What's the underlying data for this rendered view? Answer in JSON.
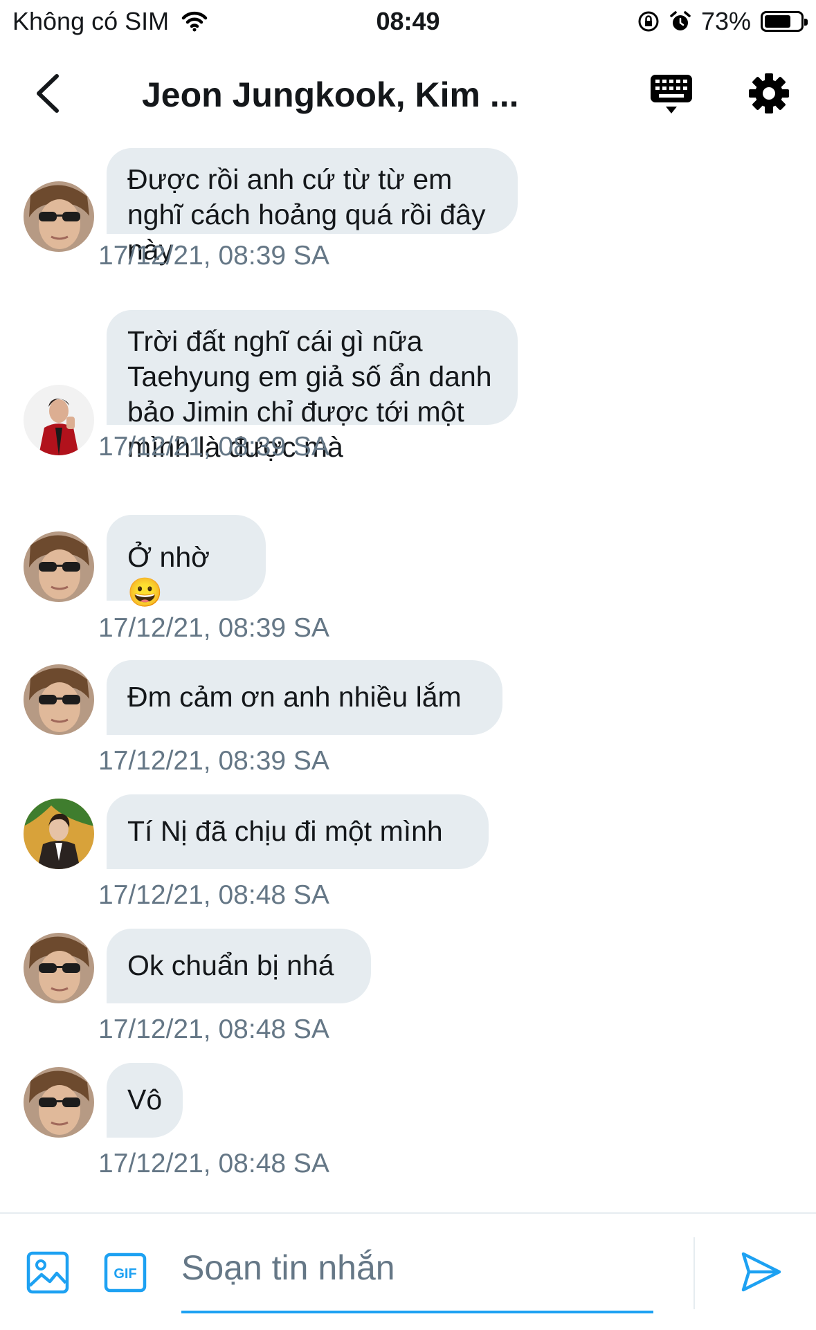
{
  "status_bar": {
    "carrier": "Không có SIM",
    "time": "08:49",
    "battery": "73%",
    "battery_level": 0.73
  },
  "header": {
    "title": "Jeon Jungkook, Kim ..."
  },
  "messages": [
    {
      "text": "Được rồi anh cứ từ từ em nghĩ cách hoảng quá rồi đây này",
      "time": "17/12/21, 08:39 SA",
      "avatar": "avatar-sunglasses"
    },
    {
      "text": "Trời đất nghĩ cái gì nữa Taehyung em giả số ẩn danh bảo Jimin chỉ được tới một mình là được mà",
      "time": "17/12/21, 08:39 SA",
      "avatar": "avatar-red-jacket"
    },
    {
      "text": "Ở nhờ 😀",
      "time": "17/12/21, 08:39 SA",
      "avatar": "avatar-sunglasses"
    },
    {
      "text": "Đm cảm ơn anh nhiều lắm",
      "time": "17/12/21, 08:39 SA",
      "avatar": "avatar-sunglasses"
    },
    {
      "text": "Tí Nị đã chịu đi một mình",
      "time": "17/12/21, 08:48 SA",
      "avatar": "avatar-green-bg"
    },
    {
      "text": "Ok chuẩn bị nhá",
      "time": "17/12/21, 08:48 SA",
      "avatar": "avatar-sunglasses"
    },
    {
      "text": "Vô",
      "time": "17/12/21, 08:48 SA",
      "avatar": "avatar-sunglasses"
    }
  ],
  "composer": {
    "placeholder": "Soạn tin nhắn",
    "value": "",
    "gif_label": "GIF"
  },
  "icons": {
    "back": "chevron-left-icon",
    "keyboard": "keyboard-icon",
    "settings": "gear-icon",
    "image": "image-icon",
    "gif": "gif-icon",
    "send": "send-icon"
  },
  "colors": {
    "accent": "#1da1f2",
    "bubble": "#e6ecf0",
    "secondary_text": "#657786"
  }
}
